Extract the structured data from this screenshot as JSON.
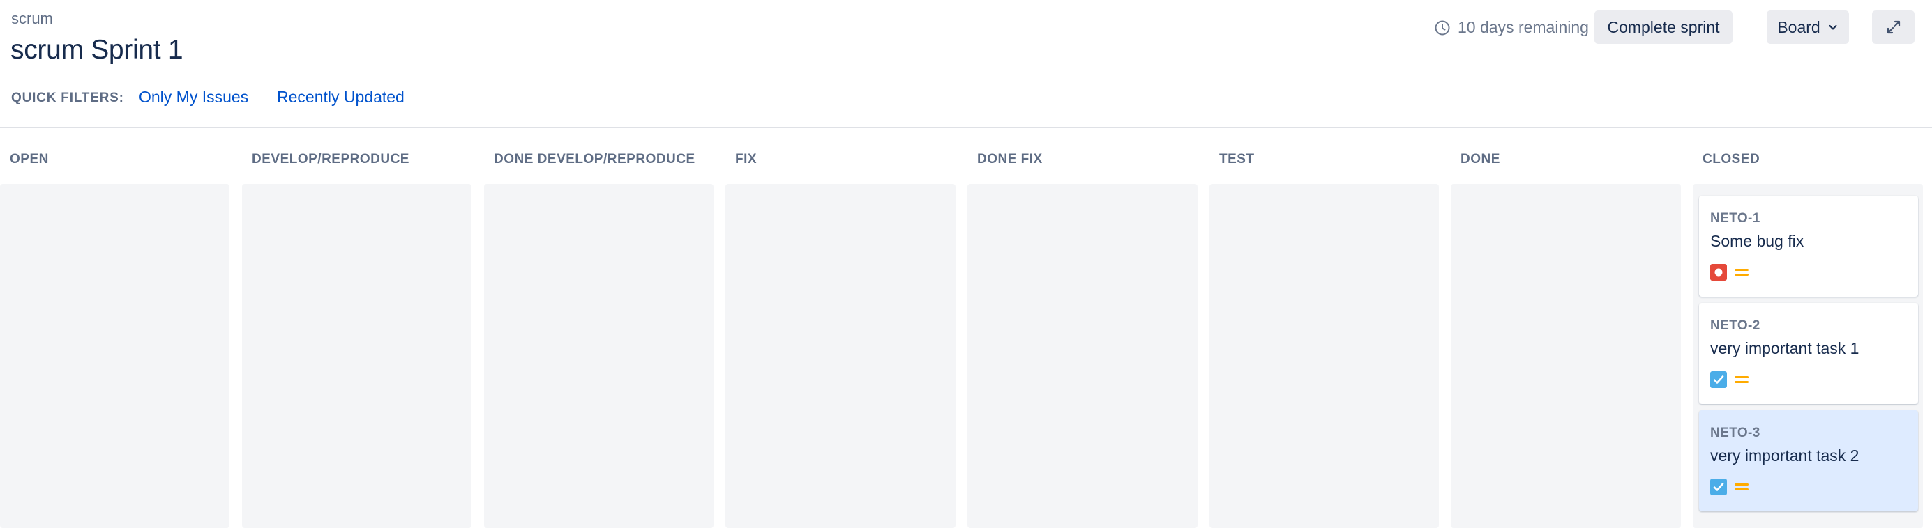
{
  "breadcrumb": "scrum",
  "title": "scrum Sprint 1",
  "sprint": {
    "remaining": "10 days remaining",
    "complete_label": "Complete sprint",
    "board_label": "Board"
  },
  "quick_filters": {
    "label": "QUICK FILTERS:",
    "items": [
      "Only My Issues",
      "Recently Updated"
    ]
  },
  "columns": [
    "OPEN",
    "DEVELOP/REPRODUCE",
    "DONE DEVELOP/REPRODUCE",
    "FIX",
    "DONE FIX",
    "TEST",
    "DONE",
    "CLOSED"
  ],
  "cards": [
    {
      "key": "NETO-1",
      "summary": "Some bug fix",
      "type_icon": "bug-icon",
      "priority_icon": "priority-medium-icon",
      "selected": false
    },
    {
      "key": "NETO-2",
      "summary": "very important task 1",
      "type_icon": "task-icon",
      "priority_icon": "priority-medium-icon",
      "selected": false
    },
    {
      "key": "NETO-3",
      "summary": "very important task 2",
      "type_icon": "task-icon",
      "priority_icon": "priority-medium-icon",
      "selected": true
    }
  ],
  "colors": {
    "accent": "#0052cc",
    "bug": "#e5493a",
    "task": "#4bade8",
    "priority_medium": "#ffab00",
    "column_bg": "#f4f5f7",
    "selected_card": "#deebff"
  }
}
